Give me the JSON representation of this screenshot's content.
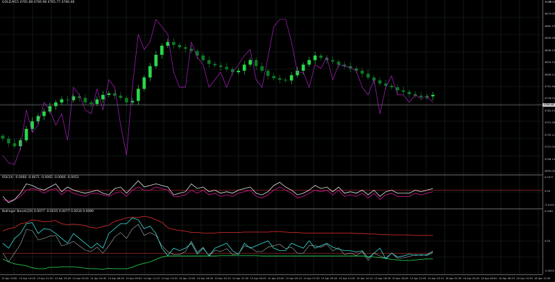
{
  "main_pane": {
    "title": "GOLD,M15  4765.88 4766.98 4765.77 4766.48",
    "y_min": 4680.0,
    "y_max": 4900.0,
    "current_price_label": "4766.48",
    "current_price": 4766.48
  },
  "rsi_pane": {
    "title": "RSI(14)  -0.0066 -0.0071 -0.0065 -0.0066 -0.0053",
    "y_min": -0.01,
    "y_max": 0.0077
  },
  "bb_pane": {
    "title": "Bollinger Bands(20)  0.0077 -0.0035 0.0077 0.0034 0.0089",
    "y_min": -0.0035,
    "y_max": 0.0081
  },
  "price_axis_main": [
    "4900.00",
    "4879.00",
    "4862.33",
    "4849.56",
    "4836.23",
    "4820.15",
    "4806.12",
    "4791.36",
    "4778.02",
    "4764.33",
    "4751.28",
    "4735.11",
    "4721.04",
    "4706.19",
    "4695.00"
  ],
  "price_axis_rsi": [
    "0.0077",
    "0.00",
    "-0.0100"
  ],
  "price_axis_bb": [
    "0.0081",
    "0.00",
    "-0.0035"
  ],
  "time_axis": [
    "13 Apr 2026",
    "13 Apr 19:45",
    "13 Apr 21:30",
    "13 Apr 23:45",
    "14 Apr 02:00",
    "14 Apr 04:30",
    "14 Apr 06:45",
    "14 Apr 09:00",
    "14 Apr 11:15",
    "14 Apr 13:30",
    "14 Apr 15:45",
    "14 Apr 18:00",
    "14 Apr 20:15",
    "14 Apr 22:30",
    "15 Apr 00:45",
    "15 Apr 03:00",
    "15 Apr 05:15",
    "15 Apr 07:30",
    "15 Apr 09:45",
    "15 Apr 12:00",
    "15 Apr 14:15",
    "15 Apr 16:30",
    "15 Apr 18:45",
    "15 Apr 21:00",
    "15 Apr 23:15",
    "16 Apr 01:30",
    "16 Apr 03:45",
    "16 Apr 06:00",
    "16 Apr 08:15",
    "16 Apr 10:30",
    "16 Apr 12:45"
  ],
  "colors": {
    "bull": "#28d84a",
    "bear": "#0c7a26",
    "overlay": "#b020c8",
    "rsi_main": "#e8e8e8",
    "rsi_signal": "#c01888",
    "rsi_mid": "#c03030",
    "bb_upper": "#cc2a2a",
    "bb_lower": "#22c84a",
    "bb_mid": "#b0b0b0",
    "bb_price": "#30c8c0",
    "grid": "#1e2b2b"
  },
  "chart_data": {
    "type": "line",
    "title": "GOLD,M15",
    "candles_close": [
      4722,
      4716,
      4712,
      4720,
      4735,
      4745,
      4752,
      4758,
      4765,
      4770,
      4774,
      4773,
      4778,
      4776,
      4770,
      4768,
      4774,
      4780,
      4782,
      4779,
      4776,
      4770,
      4772,
      4788,
      4803,
      4818,
      4833,
      4845,
      4850,
      4846,
      4843,
      4841,
      4838,
      4832,
      4826,
      4821,
      4819,
      4817,
      4814,
      4810,
      4812,
      4820,
      4826,
      4818,
      4812,
      4805,
      4802,
      4800,
      4799,
      4806,
      4812,
      4820,
      4826,
      4832,
      4829,
      4826,
      4824,
      4820,
      4818,
      4815,
      4812,
      4808,
      4803,
      4799,
      4795,
      4792,
      4790,
      4786,
      4784,
      4781,
      4779,
      4777,
      4778,
      4780
    ],
    "overlay_series": [
      4700,
      4690,
      4688,
      4710,
      4760,
      4730,
      4740,
      4770,
      4760,
      4740,
      4755,
      4720,
      4790,
      4780,
      4760,
      4755,
      4788,
      4760,
      4800,
      4790,
      4740,
      4700,
      4790,
      4860,
      4840,
      4850,
      4880,
      4870,
      4860,
      4810,
      4790,
      4790,
      4850,
      4830,
      4820,
      4790,
      4800,
      4810,
      4790,
      4810,
      4820,
      4832,
      4840,
      4800,
      4790,
      4830,
      4870,
      4880,
      4880,
      4850,
      4810,
      4810,
      4790,
      4820,
      4815,
      4830,
      4800,
      4820,
      4818,
      4816,
      4812,
      4790,
      4780,
      4800,
      4755,
      4790,
      4805,
      4780,
      4780,
      4770,
      4780,
      4775,
      4778,
      4770
    ],
    "rsi_values": [
      -0.004,
      -0.008,
      -0.006,
      -0.002,
      0.004,
      0.003,
      0.001,
      0.0,
      0.002,
      0.004,
      -0.001,
      0.002,
      0.0,
      -0.001,
      -0.002,
      -0.001,
      0.0,
      -0.002,
      -0.003,
      0.001,
      0.002,
      -0.002,
      0.002,
      0.006,
      0.002,
      0.003,
      0.004,
      0.003,
      0.002,
      -0.003,
      -0.002,
      -0.001,
      0.004,
      0.001,
      0.002,
      -0.001,
      0.0,
      -0.002,
      -0.001,
      -0.002,
      0.0,
      0.001,
      0.002,
      -0.002,
      -0.003,
      -0.001,
      0.003,
      0.005,
      0.002,
      0.0,
      -0.003,
      -0.002,
      0.0,
      0.003,
      0.001,
      0.002,
      -0.001,
      0.002,
      -0.002,
      -0.001,
      -0.002,
      0.0,
      -0.003,
      0.0,
      -0.004,
      -0.001,
      0.0,
      -0.002,
      -0.002,
      -0.002,
      0.0,
      -0.001,
      0.0,
      0.001
    ],
    "rsi_signal": [
      -0.006,
      -0.007,
      -0.006,
      -0.004,
      0.0,
      0.001,
      0.0,
      -0.002,
      0.0,
      0.001,
      -0.003,
      0.0,
      -0.002,
      -0.003,
      -0.004,
      -0.002,
      -0.002,
      -0.003,
      -0.004,
      -0.002,
      -0.001,
      -0.004,
      0.0,
      0.002,
      0.0,
      0.0,
      0.002,
      0.001,
      0.0,
      -0.004,
      -0.004,
      -0.003,
      0.0,
      -0.002,
      0.0,
      -0.003,
      -0.002,
      -0.004,
      -0.003,
      -0.004,
      -0.002,
      -0.001,
      0.0,
      -0.004,
      -0.005,
      -0.003,
      0.0,
      0.002,
      0.0,
      -0.002,
      -0.005,
      -0.004,
      -0.002,
      0.0,
      -0.001,
      0.0,
      -0.003,
      0.0,
      -0.004,
      -0.003,
      -0.004,
      -0.002,
      -0.005,
      -0.002,
      -0.006,
      -0.003,
      -0.002,
      -0.004,
      -0.004,
      -0.004,
      -0.002,
      -0.003,
      -0.002,
      -0.001
    ],
    "bb_upper": [
      0.0045,
      0.005,
      0.0052,
      0.006,
      0.0062,
      0.0068,
      0.0066,
      0.0064,
      0.0065,
      0.0066,
      0.006,
      0.0058,
      0.0059,
      0.0058,
      0.0056,
      0.0052,
      0.0051,
      0.0054,
      0.0057,
      0.0065,
      0.0068,
      0.0072,
      0.0073,
      0.0073,
      0.0075,
      0.0073,
      0.0068,
      0.0063,
      0.0052,
      0.0048,
      0.0046,
      0.0045,
      0.0042,
      0.0042,
      0.0041,
      0.0041,
      0.0041,
      0.0042,
      0.0042,
      0.0042,
      0.0042,
      0.0043,
      0.0043,
      0.0043,
      0.0043,
      0.0043,
      0.0044,
      0.0044,
      0.0043,
      0.0042,
      0.0042,
      0.0041,
      0.0041,
      0.0041,
      0.0041,
      0.0041,
      0.0041,
      0.0041,
      0.0041,
      0.0041,
      0.004,
      0.004,
      0.0039,
      0.0039,
      0.0038,
      0.0038,
      0.0037,
      0.0037,
      0.0037,
      0.0037,
      0.0036,
      0.0036,
      0.0036,
      0.0036
    ],
    "bb_mid": [
      0.0,
      0.0,
      0.0,
      0.0,
      0.0,
      0.0,
      0.0,
      0.0,
      0.0,
      0.0,
      0.0,
      0.0,
      0.0,
      0.0,
      0.0,
      0.0,
      0.0,
      0.0,
      0.0,
      0.0,
      0.0,
      0.0,
      0.0,
      0.0,
      0.0,
      0.0,
      0.0,
      0.0,
      0.0,
      0.0,
      0.0,
      0.0,
      0.0,
      0.0,
      0.0,
      0.0,
      0.0,
      0.0,
      0.0,
      0.0,
      0.0,
      0.0,
      0.0,
      0.0,
      0.0,
      0.0,
      0.0,
      0.0,
      0.0,
      0.0,
      0.0,
      0.0,
      0.0,
      0.0,
      0.0,
      0.0,
      0.0,
      0.0,
      0.0,
      0.0,
      0.0,
      0.0,
      0.0,
      0.0,
      0.0,
      0.0,
      0.0,
      0.0,
      0.0,
      0.0,
      0.0,
      0.0,
      0.0,
      0.0
    ],
    "bb_lower": [
      -0.0012,
      -0.0018,
      -0.0022,
      -0.0024,
      -0.0026,
      -0.003,
      -0.0032,
      -0.0032,
      -0.0029,
      -0.0029,
      -0.0028,
      -0.0028,
      -0.0028,
      -0.0029,
      -0.0031,
      -0.0032,
      -0.0032,
      -0.0033,
      -0.0031,
      -0.0032,
      -0.0032,
      -0.0032,
      -0.0029,
      -0.0024,
      -0.0021,
      -0.0018,
      -0.0013,
      -0.0008,
      -0.0006,
      -0.0006,
      -0.0006,
      -0.0006,
      -0.0006,
      -0.0006,
      -0.0006,
      -0.0006,
      -0.0006,
      -0.0005,
      -0.0005,
      -0.0005,
      -0.0005,
      -0.0005,
      -0.0005,
      -0.0005,
      -0.0006,
      -0.0006,
      -0.0006,
      -0.0006,
      -0.0006,
      -0.0006,
      -0.0006,
      -0.0006,
      -0.0006,
      -0.0006,
      -0.0006,
      -0.0006,
      -0.0006,
      -0.0006,
      -0.0006,
      -0.0006,
      -0.0006,
      -0.0006,
      -0.0007,
      -0.0008,
      -0.0009,
      -0.0011,
      -0.0013,
      -0.0014,
      -0.0015,
      -0.0015,
      -0.0014,
      -0.0013,
      -0.0012,
      -0.0012
    ],
    "bb_price": [
      0.002,
      0.001,
      0.003,
      0.004,
      0.006,
      0.0062,
      0.004,
      0.005,
      0.0048,
      0.004,
      0.003,
      0.002,
      0.004,
      0.003,
      0.002,
      0.001,
      0.002,
      0.001,
      0.004,
      0.005,
      0.006,
      0.006,
      0.0072,
      0.0068,
      0.005,
      0.0055,
      0.004,
      0.001,
      -0.0005,
      0.001,
      0.0005,
      0.001,
      0.002,
      -0.0002,
      0.001,
      -0.0005,
      0.001,
      0.0015,
      0.002,
      0.0005,
      -0.0003,
      0.002,
      0.001,
      0.0015,
      0.002,
      0.0025,
      0.001,
      0.0005,
      0.0005,
      0.002,
      0.0015,
      0.001,
      0.0025,
      0.001,
      0.0015,
      0.002,
      0.0012,
      0.0008,
      0.0005,
      0.0005,
      0.0002,
      0.0005,
      -0.001,
      0.0,
      0.001,
      -0.0012,
      0.0,
      -0.0008,
      -0.0006,
      -0.0002,
      -0.0005,
      -0.0003,
      -0.0005,
      0.0002
    ]
  }
}
